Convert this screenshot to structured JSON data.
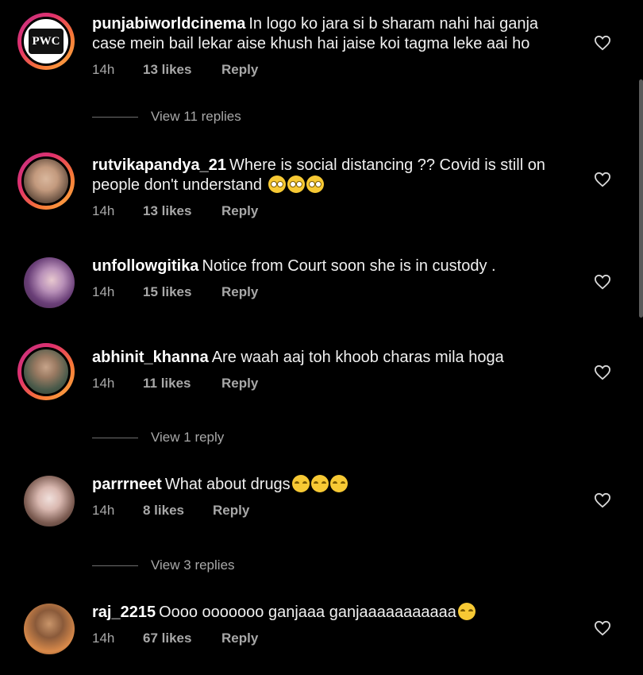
{
  "comments": [
    {
      "user": "punjabiworldcinema",
      "text": "In logo ko jara si b sharam nahi hai ganja case mein bail lekar aise khush hai jaise koi tagma leke aai ho",
      "time": "14h",
      "likes": "13 likes",
      "reply": "Reply",
      "logo_text": "PWC",
      "view_replies": "View 11 replies"
    },
    {
      "user": "rutvikapandya_21",
      "text": "Where is social distancing ?? Covid is still on people don't understand",
      "time": "14h",
      "likes": "13 likes",
      "reply": "Reply",
      "emojis": [
        "rolling-eyes",
        "rolling-eyes",
        "rolling-eyes"
      ]
    },
    {
      "user": "unfollowgitika",
      "text": "Notice from Court soon she is in custody .",
      "time": "14h",
      "likes": "15 likes",
      "reply": "Reply"
    },
    {
      "user": "abhinit_khanna",
      "text": "Are waah aaj toh khoob charas mila hoga",
      "time": "14h",
      "likes": "11 likes",
      "reply": "Reply",
      "view_replies": "View 1 reply"
    },
    {
      "user": "parrrneet",
      "text": "What about drugs",
      "time": "14h",
      "likes": "8 likes",
      "reply": "Reply",
      "emojis": [
        "laughing",
        "laughing",
        "laughing"
      ],
      "view_replies": "View 3 replies"
    },
    {
      "user": "raj_2215",
      "text": "Oooo ooooooo ganjaaa ganjaaaaaaaaaaa",
      "time": "14h",
      "likes": "67 likes",
      "reply": "Reply",
      "emojis": [
        "laughing"
      ]
    }
  ],
  "colors": {
    "background": "#000000",
    "text": "#f0f0f0",
    "meta": "#a8a8a8",
    "ring": "#e1306c"
  }
}
